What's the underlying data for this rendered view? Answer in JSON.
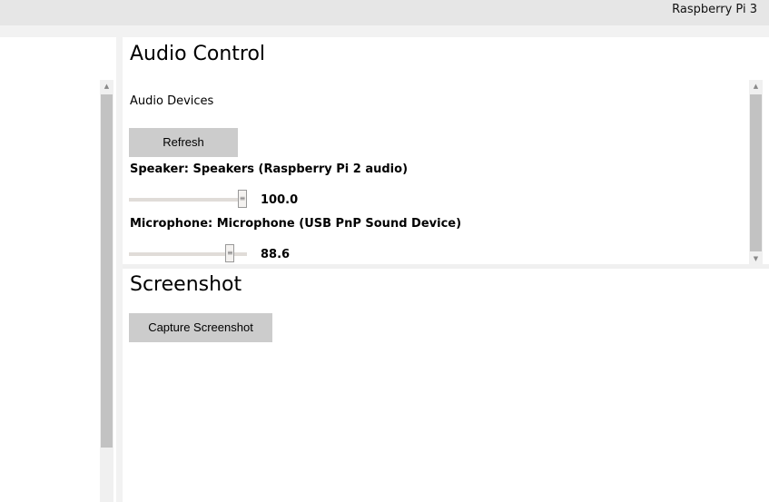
{
  "header": {
    "device_name": "Raspberry Pi 3"
  },
  "audio": {
    "title": "Audio Control",
    "devices_label": "Audio Devices",
    "refresh_label": "Refresh",
    "speaker": {
      "label": "Speaker: Speakers (Raspberry Pi 2 audio)",
      "value": "100.0",
      "fraction": 1.0
    },
    "microphone": {
      "label": "Microphone: Microphone (USB PnP Sound Device)",
      "value": "88.6",
      "fraction": 0.886
    }
  },
  "screenshot": {
    "title": "Screenshot",
    "capture_label": "Capture Screenshot"
  }
}
